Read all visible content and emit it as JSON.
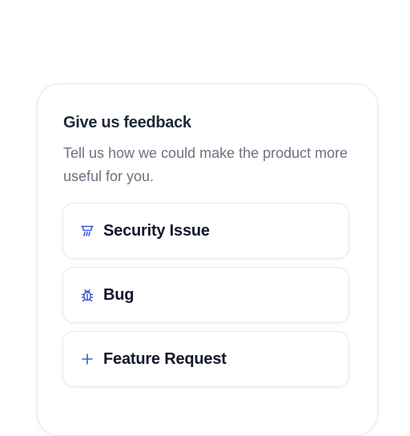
{
  "feedback": {
    "title": "Give us feedback",
    "description": "Tell us how we could make the product more useful for you.",
    "options": [
      {
        "label": "Security Issue",
        "icon": "shield-icon"
      },
      {
        "label": "Bug",
        "icon": "bug-icon"
      },
      {
        "label": "Feature Request",
        "icon": "plus-icon"
      }
    ]
  },
  "colors": {
    "accent": "#3b5bdb",
    "title": "#1f2937",
    "body_text": "#6b7280",
    "border": "#e5e7eb"
  }
}
